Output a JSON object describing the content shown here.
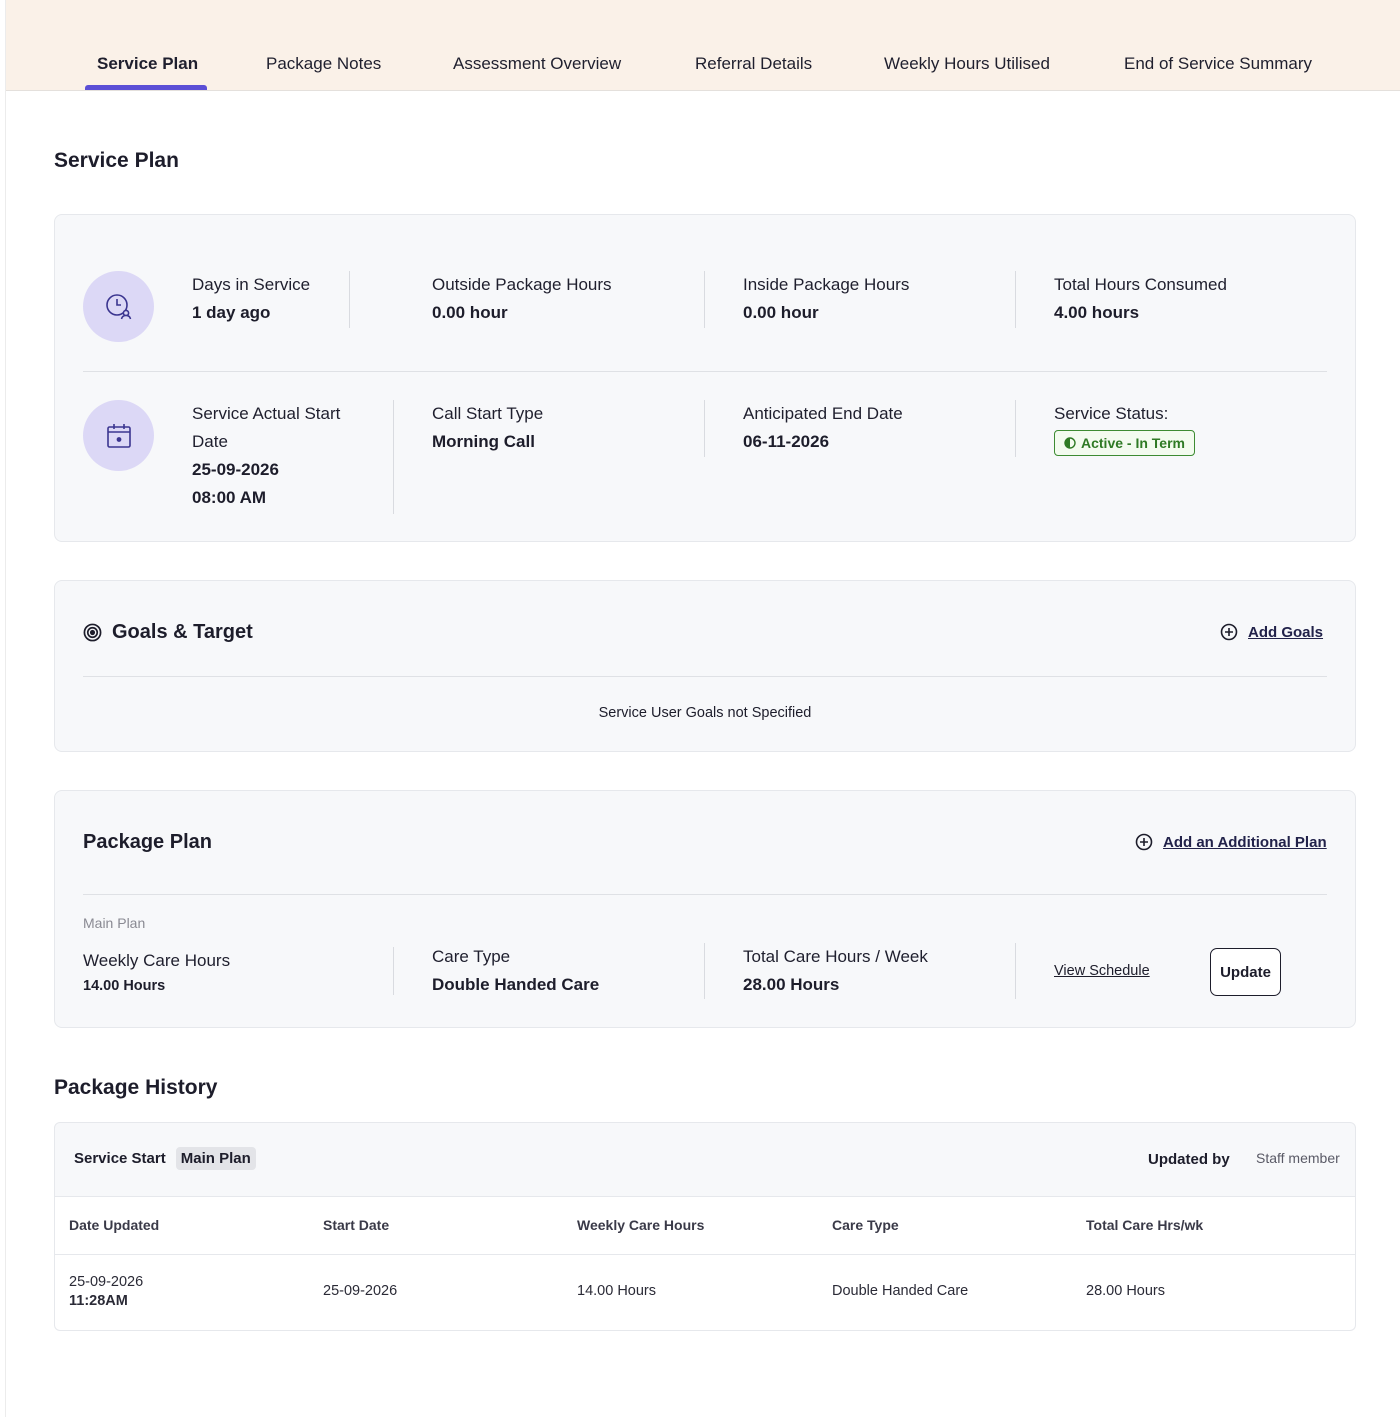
{
  "tabs": [
    {
      "label": "Service Plan",
      "active": true
    },
    {
      "label": "Package Notes"
    },
    {
      "label": "Assessment Overview"
    },
    {
      "label": "Referral Details"
    },
    {
      "label": "Weekly Hours Utilised"
    },
    {
      "label": "End of Service Summary"
    }
  ],
  "colors": {
    "accent": "#5b4fd6",
    "tabbar_bg": "#faf1e8",
    "status_green": "#2f7a25",
    "icon_bg": "#dcd8f6"
  },
  "service_plan": {
    "title": "Service Plan",
    "row1": {
      "icon": "clock-user-icon",
      "days_in_service": {
        "label": "Days in Service",
        "value": "1 day ago"
      },
      "outside_package_hours": {
        "label": "Outside Package Hours",
        "value": "0.00 hour"
      },
      "inside_package_hours": {
        "label": "Inside Package Hours",
        "value": "0.00 hour"
      },
      "total_hours_consumed": {
        "label": "Total Hours Consumed",
        "value": "4.00 hours"
      }
    },
    "row2": {
      "icon": "calendar-icon",
      "start_date": {
        "label_line1": "Service Actual Start",
        "label_line2": "Date",
        "date": "25-09-2026",
        "time": "08:00 AM"
      },
      "call_start_type": {
        "label": "Call Start Type",
        "value": "Morning Call"
      },
      "anticipated_end_date": {
        "label": "Anticipated End Date",
        "value": "06-11-2026"
      },
      "service_status": {
        "label": "Service Status:",
        "value": "Active - In Term"
      }
    }
  },
  "goals": {
    "title": "Goals & Target",
    "add_label": "Add Goals",
    "empty_text": "Service User Goals not Specified"
  },
  "package_plan": {
    "title": "Package Plan",
    "add_label": "Add an Additional Plan",
    "main_plan_label": "Main Plan",
    "weekly_care_hours": {
      "label": "Weekly Care Hours",
      "value": "14.00 Hours"
    },
    "care_type": {
      "label": "Care Type",
      "value": "Double Handed Care"
    },
    "total_care_hours": {
      "label": "Total Care Hours / Week",
      "value": "28.00 Hours"
    },
    "view_schedule": "View Schedule",
    "update": "Update"
  },
  "package_history": {
    "title": "Package History",
    "service_start_label": "Service Start",
    "chip": "Main Plan",
    "updated_by_label": "Updated by",
    "updated_by_value": "Staff member",
    "columns": [
      "Date Updated",
      "Start Date",
      "Weekly Care Hours",
      "Care Type",
      "Total Care Hrs/wk"
    ],
    "rows": [
      {
        "date_updated": "25-09-2026",
        "time_updated": "11:28AM",
        "start_date": "25-09-2026",
        "weekly_care_hours": "14.00 Hours",
        "care_type": "Double Handed Care",
        "total_care_hrs": "28.00 Hours"
      }
    ]
  }
}
